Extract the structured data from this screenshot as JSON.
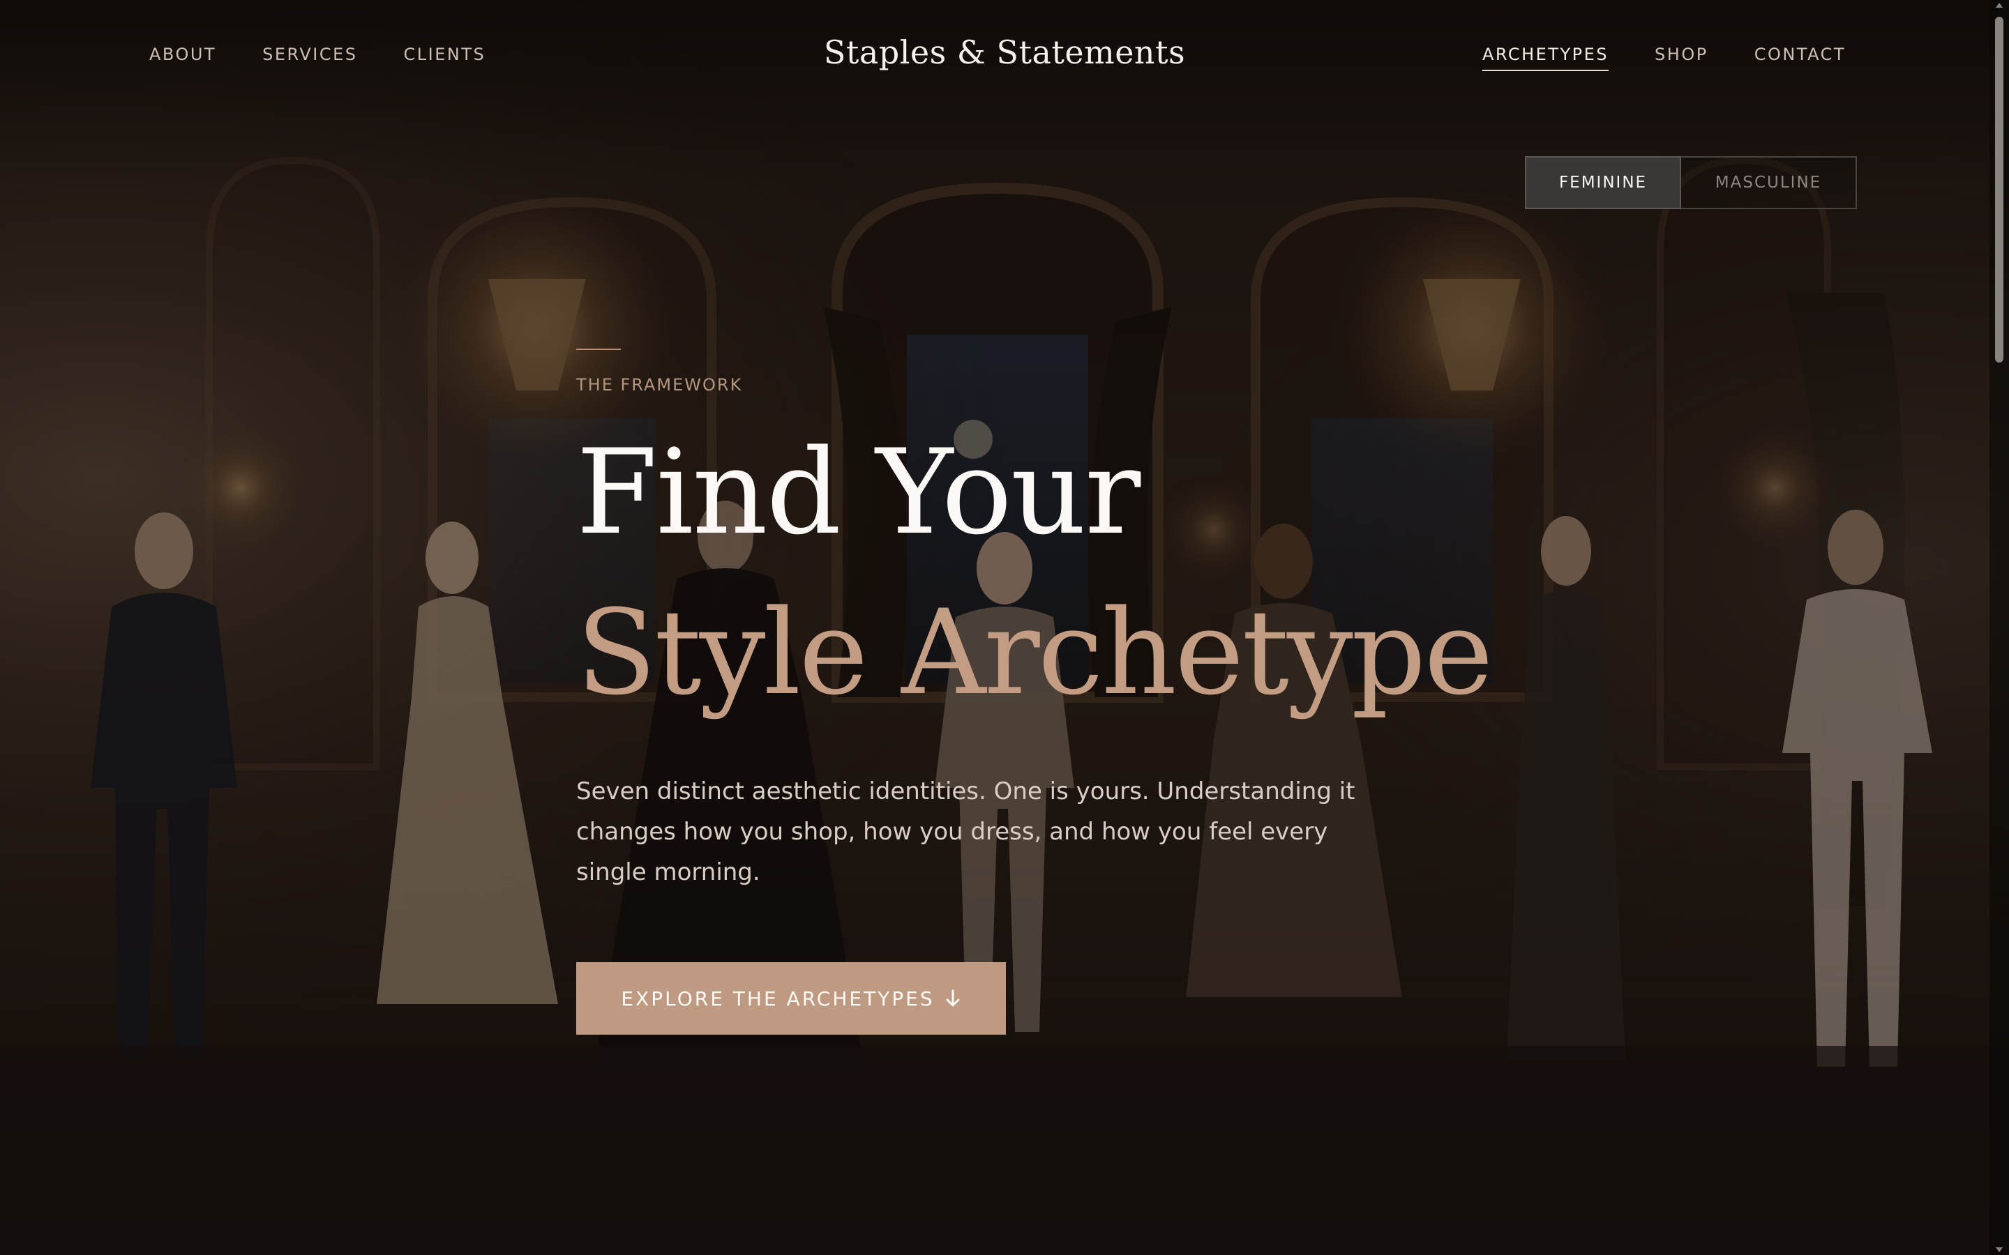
{
  "header": {
    "brand": "Staples & Statements",
    "nav_left": [
      {
        "label": "ABOUT"
      },
      {
        "label": "SERVICES"
      },
      {
        "label": "CLIENTS"
      }
    ],
    "nav_right": [
      {
        "label": "ARCHETYPES",
        "active": true
      },
      {
        "label": "SHOP"
      },
      {
        "label": "CONTACT"
      }
    ]
  },
  "toggle": {
    "options": [
      {
        "label": "FEMININE",
        "selected": true
      },
      {
        "label": "MASCULINE",
        "selected": false
      }
    ]
  },
  "hero": {
    "eyebrow": "THE FRAMEWORK",
    "title_line1": "Find Your",
    "title_line2": "Style Archetype",
    "description": "Seven distinct aesthetic identities. One is yours. Understanding it changes how you shop, how you dress, and how you feel every single morning.",
    "cta_label": "EXPLORE THE ARCHETYPES",
    "cta_icon": "arrow-down-icon"
  },
  "background": {
    "subject": "ballroom-with-chandeliers-and-seven-models",
    "colors": {
      "dark": "#1a1411",
      "accent": "#c39c84",
      "warm_light": "#d9a86a"
    }
  }
}
